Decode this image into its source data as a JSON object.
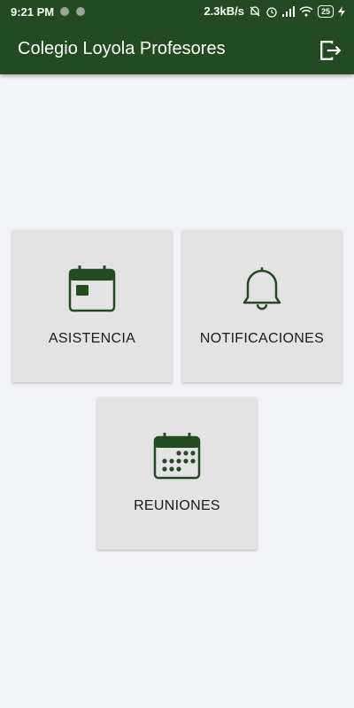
{
  "status_bar": {
    "time": "9:21 PM",
    "net_speed": "2.3kB/s",
    "battery": "25"
  },
  "app_bar": {
    "title": "Colegio Loyola Profesores",
    "logout_icon": "logout-icon"
  },
  "menu": {
    "items": [
      {
        "label": "ASISTENCIA",
        "icon": "calendar-day-icon"
      },
      {
        "label": "NOTIFICACIONES",
        "icon": "bell-icon"
      },
      {
        "label": "REUNIONES",
        "icon": "calendar-month-icon"
      }
    ]
  },
  "colors": {
    "primary": "#234a20",
    "background": "#f2f3f7",
    "card": "#e3e3e3"
  }
}
